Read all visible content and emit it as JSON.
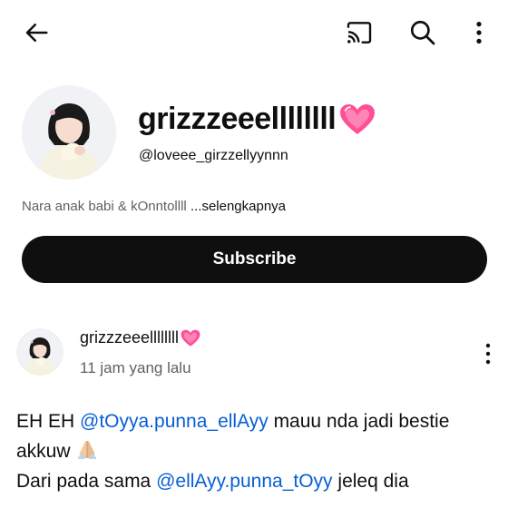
{
  "topbar": {
    "back_icon": "arrow-left-icon",
    "cast_icon": "cast-icon",
    "search_icon": "search-icon",
    "more_icon": "more-vertical-icon"
  },
  "channel": {
    "name": "grizzzeeellllllll",
    "handle": "@loveee_girzzellyynnn",
    "description": "Nara anak babi & kOnntollll",
    "more_link": "...selengkapnya",
    "subscribe_label": "Subscribe"
  },
  "post": {
    "author": "grizzzeeellllllll",
    "time": "11 jam yang lalu",
    "text": {
      "l1_a": "EH EH ",
      "l1_mention": "@tOyya.punna_ellAyy",
      "l1_b": "  mauu nda jadi bestie",
      "l2_a": "akkuw ",
      "l3_a": "Dari pada sama ",
      "l3_mention": "@ellAyy.punna_tOyy",
      "l3_b": "  jeleq dia"
    }
  },
  "colors": {
    "accent": "#065fd4",
    "heart": "#ff4f96",
    "button": "#0f0f0f",
    "secondary_text": "#606060"
  }
}
